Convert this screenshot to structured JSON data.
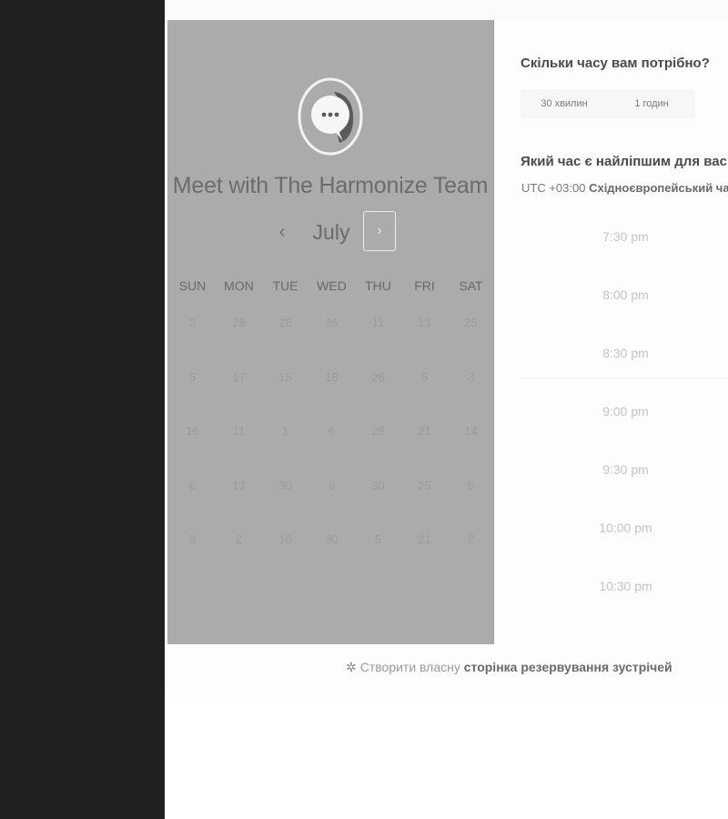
{
  "calendar": {
    "title": "Meet with The Harmonize Team",
    "month": "July",
    "prev_icon": "‹",
    "next_icon": "›",
    "weekdays": [
      "SUN",
      "MON",
      "TUE",
      "WED",
      "THU",
      "FRI",
      "SAT"
    ],
    "days": [
      "2",
      "28",
      "26",
      "26",
      "11",
      "13",
      "25",
      "5",
      "17",
      "15",
      "18",
      "26",
      "5",
      "3",
      "16",
      "11",
      "1",
      "6",
      "28",
      "21",
      "14",
      "6",
      "13",
      "30",
      "6",
      "30",
      "25",
      "5",
      "9",
      "2",
      "10",
      "30",
      "5",
      "21",
      "2"
    ]
  },
  "booking": {
    "duration_question": "Скільки часу вам потрібно?",
    "duration_options": [
      "30 хвилин",
      "1 годин"
    ],
    "time_question": "Який час є найліпшим для вас?",
    "timezone_offset": "UTC +03:00",
    "timezone_name": "Східноєвропейський час",
    "slots": [
      "7:30 pm",
      "8:00 pm",
      "8:30 pm",
      "9:00 pm",
      "9:30 pm",
      "10:00 pm",
      "10:30 pm"
    ]
  },
  "footer": {
    "prefix": "Створити власну",
    "link": "сторінка резервування зустрічей"
  },
  "colors": {
    "left_background": "#202020",
    "calendar_panel": "#ababab",
    "page_background": "#fdfdfd"
  }
}
